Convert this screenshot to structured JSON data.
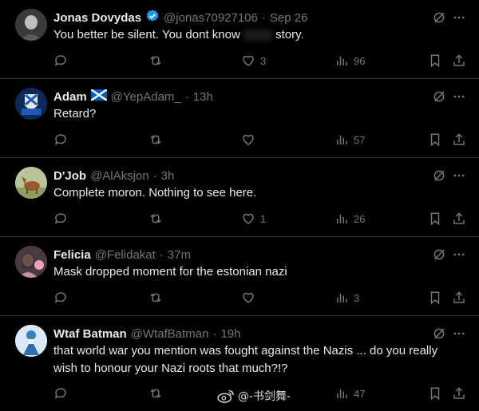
{
  "replies": [
    {
      "name": "Jonas Dovydas",
      "verified": true,
      "handle": "@jonas70927106",
      "sep": "·",
      "time": "Sep 26",
      "text": "You better be silent. You dont know your story.",
      "text_visible_before": "You better be silent. You dont know",
      "text_visible_after": "story.",
      "replies_count": "",
      "reposts_count": "",
      "likes_count": "3",
      "views_count": "96",
      "avatar_color": "#2a2a2a"
    },
    {
      "name": "Adam",
      "flag": "scotland",
      "handle": "@YepAdam_",
      "sep": "·",
      "time": "13h",
      "text": "Retard?",
      "replies_count": "",
      "reposts_count": "",
      "likes_count": "",
      "views_count": "57",
      "avatar_color": "#0b2a5a"
    },
    {
      "name": "D'Job",
      "handle": "@AlAksjon",
      "sep": "·",
      "time": "3h",
      "text": "Complete moron. Nothing to see here.",
      "replies_count": "",
      "reposts_count": "",
      "likes_count": "1",
      "views_count": "26",
      "avatar_color": "#8a6b3c"
    },
    {
      "name": "Felicia",
      "handle": "@Felidakat",
      "sep": "·",
      "time": "37m",
      "text": "Mask dropped moment for the estonian nazi",
      "replies_count": "",
      "reposts_count": "",
      "likes_count": "",
      "views_count": "3",
      "avatar_color": "#6a5560"
    },
    {
      "name": "Wtaf Batman",
      "handle": "@WtafBatman",
      "sep": "·",
      "time": "19h",
      "text_line1": "that world war you mention was fought against the Nazis ... do you really",
      "text_line2": "wish to honour your Nazi roots that much?!?",
      "replies_count": "",
      "reposts_count": "",
      "likes_count": "",
      "views_count": "47",
      "avatar_color": "#cfe3f2"
    }
  ],
  "watermark": "@-书剑舞-",
  "colors": {
    "background": "#000000",
    "text": "#e7e9ea",
    "muted": "#71767b",
    "verified": "#1d9bf0",
    "divider": "#2f3336"
  }
}
